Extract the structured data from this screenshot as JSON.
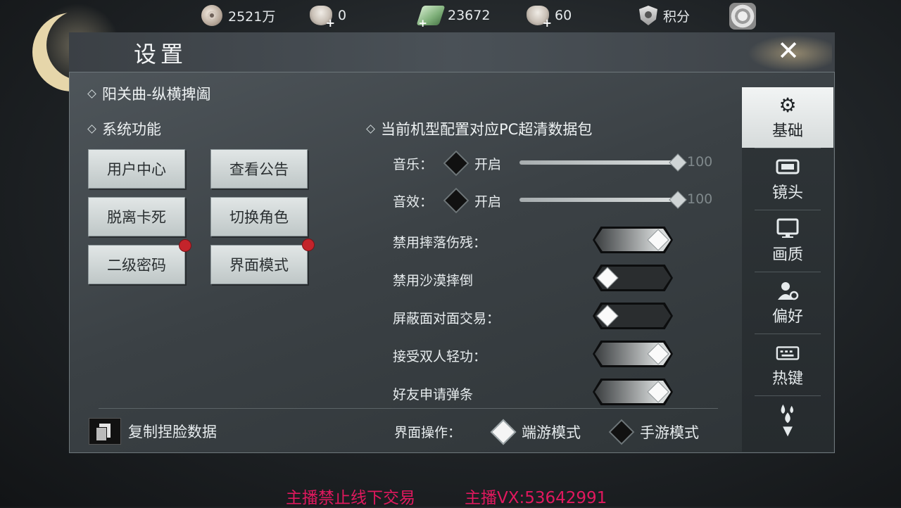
{
  "topbar": {
    "silver": "2521万",
    "bowl_a": "0",
    "jade": "23672",
    "bowl_b": "60",
    "points": "积分"
  },
  "panel": {
    "title": "设置",
    "server_name": "阳关曲-纵横捭阖",
    "system_section": "系统功能",
    "data_pack": "当前机型配置对应PC超清数据包",
    "buttons": [
      "用户中心",
      "查看公告",
      "脱离卡死",
      "切换角色",
      "二级密码",
      "界面模式"
    ],
    "music_label": "音乐：",
    "music_state": "开启",
    "music_value": "100",
    "music_level": 1.0,
    "sfx_label": "音效：",
    "sfx_state": "开启",
    "sfx_value": "100",
    "sfx_level": 1.0,
    "toggles": [
      {
        "label": "禁用摔落伤残：",
        "on": true
      },
      {
        "label": "禁用沙漠摔倒",
        "on": false
      },
      {
        "label": "屏蔽面对面交易：",
        "on": false
      },
      {
        "label": "接受双人轻功：",
        "on": true
      },
      {
        "label": "好友申请弹条",
        "on": true
      }
    ],
    "copy_face": "复制捏脸数据",
    "ui_op_label": "界面操作：",
    "mode_pc": "端游模式",
    "mode_mobile": "手游模式"
  },
  "tabs": [
    "基础",
    "镜头",
    "画质",
    "偏好",
    "热键"
  ],
  "watermark": {
    "left": "主播禁止线下交易",
    "right": "主播VX:53642991"
  },
  "colors": {
    "accent_red": "#c4242b",
    "watermark": "#e0185e"
  }
}
